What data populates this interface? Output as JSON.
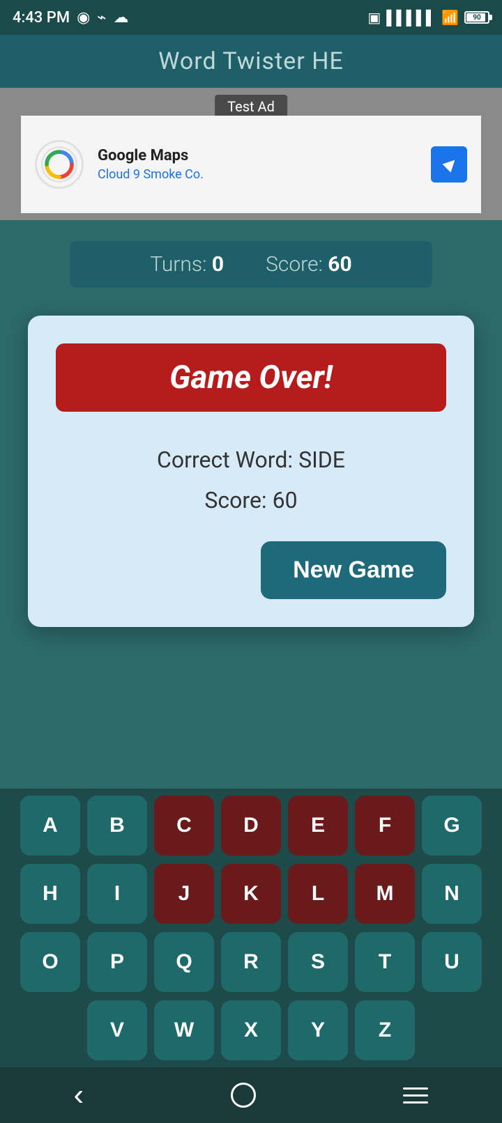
{
  "statusBar": {
    "time": "4:43 PM",
    "battery": "90"
  },
  "appTitle": "Word Twister HE",
  "ad": {
    "testAdLabel": "Test Ad",
    "advertiserName": "Google Maps",
    "advertiserSubtitle": "Cloud 9 Smoke Co."
  },
  "gameBar": {
    "turnsLabel": "Turns:",
    "turnsValue": "0",
    "scoreLabel": "Score:",
    "scoreValue": "60"
  },
  "modal": {
    "gameOverTitle": "Game Over!",
    "correctWordLabel": "Correct Word: SIDE",
    "scoreLabel": "Score: 60",
    "newGameButton": "New Game"
  },
  "keyboard": {
    "rows": [
      [
        "A",
        "B",
        "C",
        "D",
        "E",
        "F",
        "G"
      ],
      [
        "H",
        "I",
        "J",
        "K",
        "L",
        "M",
        "N"
      ],
      [
        "O",
        "P",
        "Q",
        "R",
        "S",
        "T",
        "U"
      ],
      [
        "V",
        "W",
        "X",
        "Y",
        "Z"
      ]
    ],
    "usedKeys": [
      "C",
      "D",
      "E",
      "F",
      "J",
      "K",
      "L",
      "M"
    ]
  },
  "navBar": {
    "backLabel": "<",
    "homeLabel": "○",
    "menuLabel": "≡"
  }
}
